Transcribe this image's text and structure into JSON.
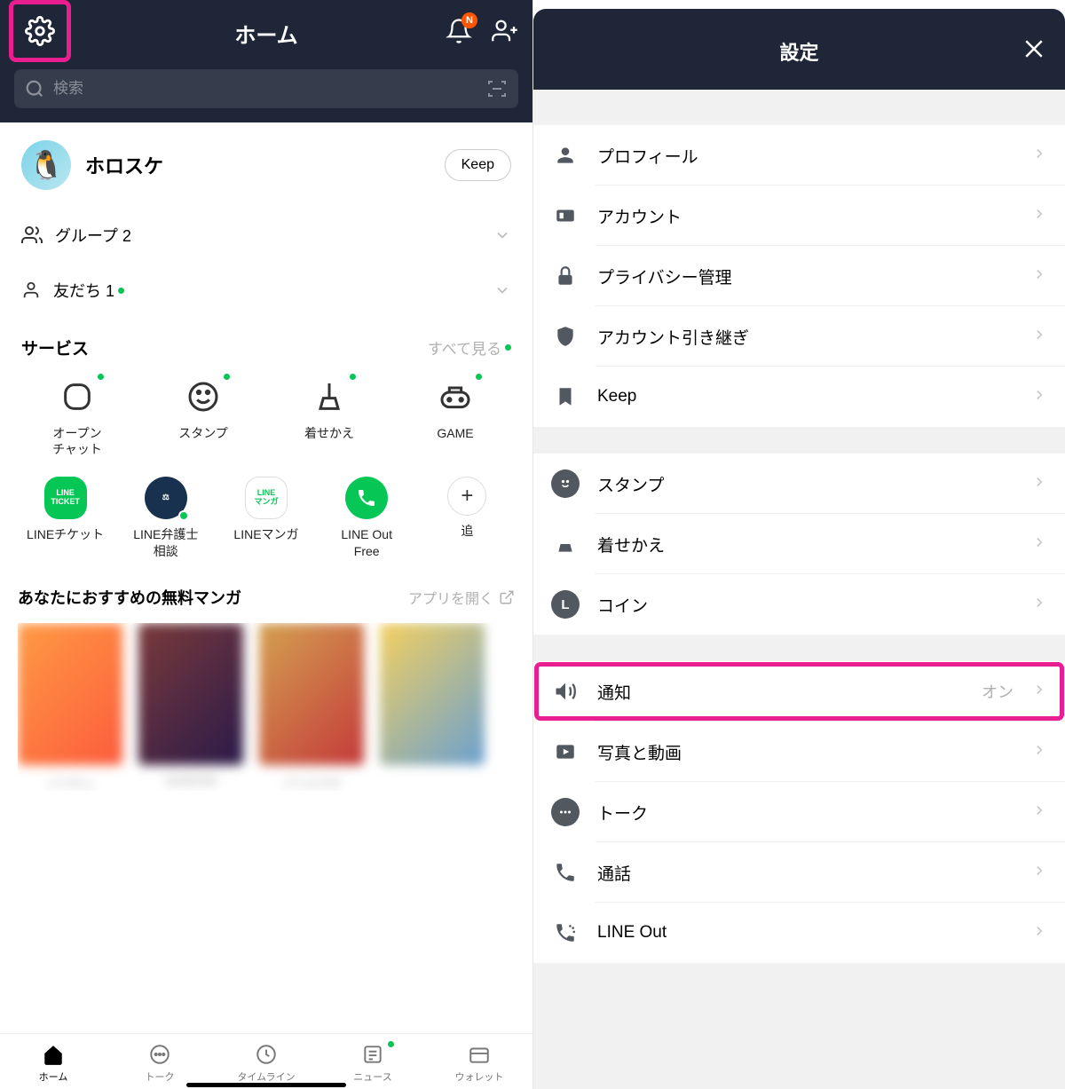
{
  "home": {
    "title": "ホーム",
    "bell_badge": "N",
    "search_placeholder": "検索",
    "profile_name": "ホロスケ",
    "keep_label": "Keep",
    "groups_label": "グループ 2",
    "friends_label": "友だち 1",
    "services": {
      "title": "サービス",
      "more": "すべて見る",
      "row1": [
        {
          "id": "openchat",
          "label": "オープン\nチャット"
        },
        {
          "id": "stamp",
          "label": "スタンプ"
        },
        {
          "id": "theme",
          "label": "着せかえ"
        },
        {
          "id": "game",
          "label": "GAME"
        }
      ],
      "row2": [
        {
          "id": "ticket",
          "label": "LINEチケット"
        },
        {
          "id": "lawyer",
          "label": "LINE弁護士\n相談"
        },
        {
          "id": "manga",
          "label": "LINEマンガ"
        },
        {
          "id": "lineout",
          "label": "LINE Out\nFree"
        },
        {
          "id": "add",
          "label": "追"
        }
      ]
    },
    "manga": {
      "title": "あなたにおすすめの無料マンガ",
      "open_app": "アプリを開く",
      "items": [
        {
          "title": "ハイキュ"
        },
        {
          "title": "SHADOW"
        },
        {
          "title": "バトルスタ"
        },
        {
          "title": ""
        }
      ]
    },
    "tabs": [
      {
        "id": "home",
        "label": "ホーム"
      },
      {
        "id": "talk",
        "label": "トーク"
      },
      {
        "id": "timeline",
        "label": "タイムライン"
      },
      {
        "id": "news",
        "label": "ニュース"
      },
      {
        "id": "wallet",
        "label": "ウォレット"
      }
    ]
  },
  "settings": {
    "title": "設定",
    "groups": [
      [
        {
          "icon": "person",
          "label": "プロフィール"
        },
        {
          "icon": "id",
          "label": "アカウント"
        },
        {
          "icon": "lock",
          "label": "プライバシー管理"
        },
        {
          "icon": "shield",
          "label": "アカウント引き継ぎ"
        },
        {
          "icon": "bookmark",
          "label": "Keep"
        }
      ],
      [
        {
          "icon": "smile-circle",
          "label": "スタンプ"
        },
        {
          "icon": "brush",
          "label": "着せかえ"
        },
        {
          "icon": "coin-circle",
          "label": "コイン"
        }
      ],
      [
        {
          "icon": "speaker",
          "label": "通知",
          "value": "オン",
          "highlighted": true
        },
        {
          "icon": "play",
          "label": "写真と動画"
        },
        {
          "icon": "dots-circle",
          "label": "トーク"
        },
        {
          "icon": "phone",
          "label": "通話"
        },
        {
          "icon": "phoneout",
          "label": "LINE Out"
        }
      ]
    ]
  }
}
